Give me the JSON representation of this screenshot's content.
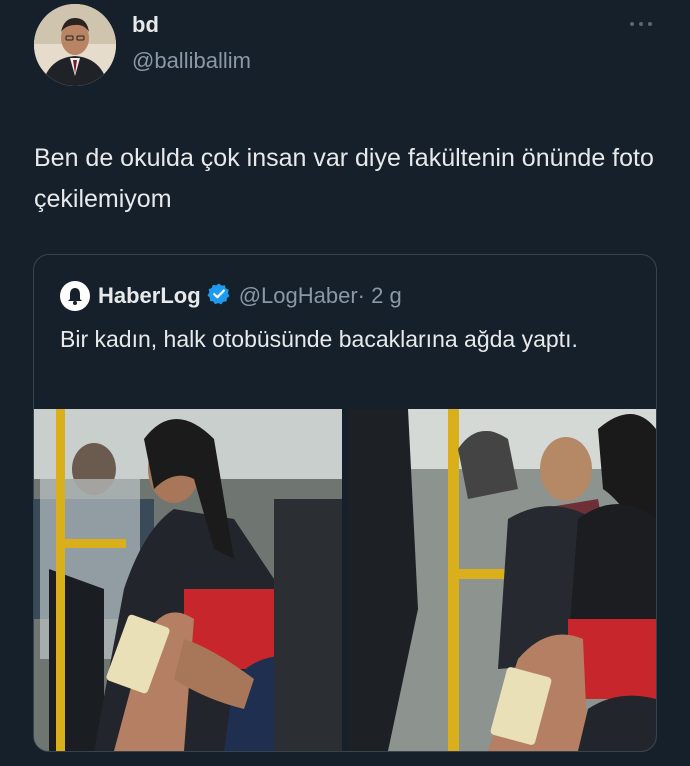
{
  "tweet": {
    "author_name": "bd",
    "author_handle": "@balliballim",
    "more_icon": "…",
    "text": "Ben de okulda çok insan var diye fakültenin önünde foto çekilemiyom"
  },
  "quoted_tweet": {
    "author_name": "HaberLog",
    "author_handle": "@LogHaber",
    "time": "· 2 g",
    "text": "Bir kadın, halk otobüsünde bacaklarına ağda yaptı.",
    "verified_color": "#1d9bf0"
  },
  "colors": {
    "background": "#15202b",
    "text": "#e7e9ea",
    "muted": "#8b98a5",
    "border": "#38444d",
    "pole_yellow": "#d9b01c",
    "skirt_red": "#c6262c"
  }
}
